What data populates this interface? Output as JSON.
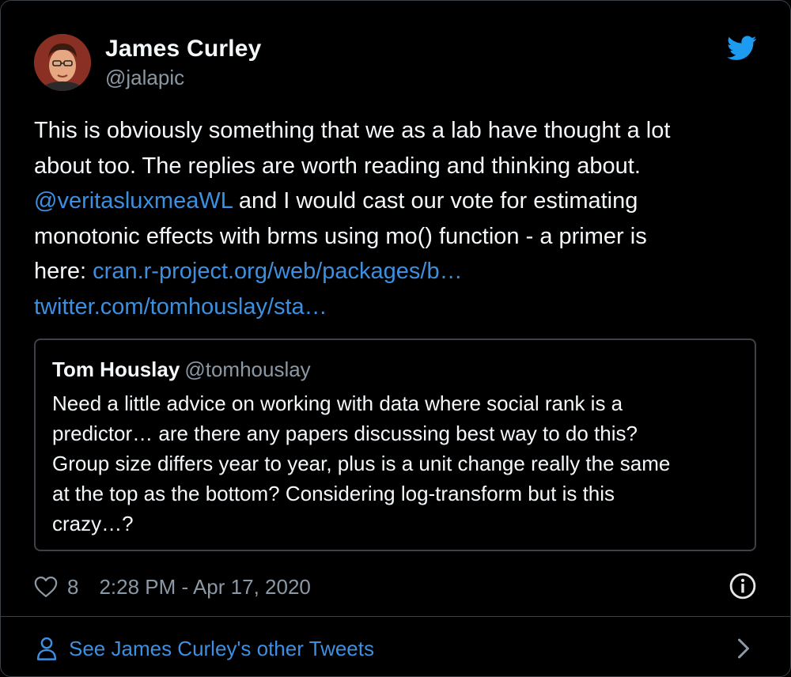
{
  "author": {
    "name": "James Curley",
    "handle": "@jalapic",
    "avatar_icon": "avatar-photo"
  },
  "tweet": {
    "line1": "This is obviously something that we as a lab have thought a lot",
    "line2": "about too. The replies are worth reading and thinking about.",
    "mention": "@veritasluxmeaWL",
    "line3_rest": " and I would cast our vote for estimating",
    "line4": "monotonic effects with brms using mo() function  - a primer is",
    "line5_prefix": "here: ",
    "link1": "cran.r-project.org/web/packages/b…",
    "link2": "twitter.com/tomhouslay/sta…"
  },
  "quoted": {
    "name": "Tom Houslay",
    "handle": "@tomhouslay",
    "line1": "Need a little advice on working with data where social rank is a",
    "line2": "predictor… are there any papers discussing best way to do this?",
    "line3": "Group size differs year to year, plus is a unit change really the same",
    "line4": "at the top as the bottom? Considering log-transform but is this",
    "line5": "crazy…?"
  },
  "meta": {
    "likes": "8",
    "timestamp": "2:28 PM - Apr 17, 2020"
  },
  "footer": {
    "label": "See James Curley's other Tweets"
  },
  "colors": {
    "background": "#000000",
    "link": "#3d8fe0",
    "twitter_blue": "#1d9bf0",
    "border": "#3d4248",
    "secondary_text": "#8b98a5"
  },
  "icons": [
    "twitter-bird-icon",
    "heart-icon",
    "info-icon",
    "person-icon",
    "chevron-right-icon"
  ]
}
